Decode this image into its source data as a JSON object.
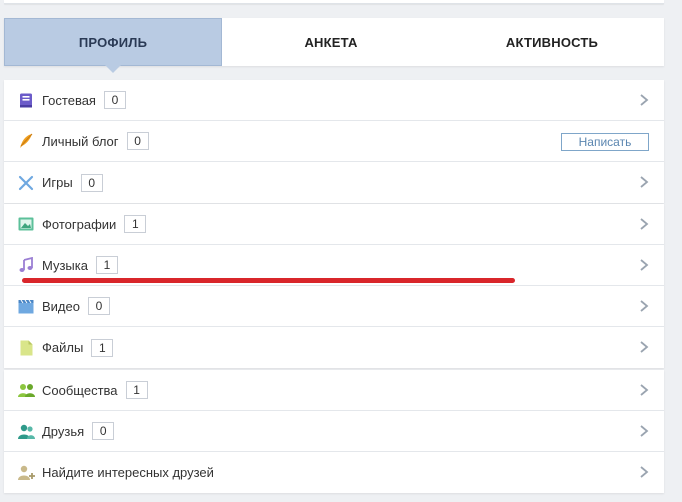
{
  "tabs": [
    {
      "label": "ПРОФИЛЬ",
      "active": true
    },
    {
      "label": "АНКЕТА",
      "active": false
    },
    {
      "label": "АКТИВНОСТЬ",
      "active": false
    }
  ],
  "groups": {
    "personal": {
      "guestbook": {
        "label": "Гостевая",
        "count": "0",
        "icon": "guestbook-icon"
      },
      "blog": {
        "label": "Личный блог",
        "count": "0",
        "icon": "quill-icon",
        "action": "Написать"
      },
      "games": {
        "label": "Игры",
        "count": "0",
        "icon": "swords-icon"
      }
    },
    "media": {
      "photos": {
        "label": "Фотографии",
        "count": "1",
        "icon": "photo-icon"
      },
      "music": {
        "label": "Музыка",
        "count": "1",
        "icon": "music-note-icon"
      },
      "video": {
        "label": "Видео",
        "count": "0",
        "icon": "film-icon"
      },
      "files": {
        "label": "Файлы",
        "count": "1",
        "icon": "file-icon"
      }
    },
    "social": {
      "communities": {
        "label": "Сообщества",
        "count": "1",
        "icon": "communities-icon"
      },
      "friends": {
        "label": "Друзья",
        "count": "0",
        "icon": "friends-icon"
      },
      "find_friends": {
        "label": "Найдите интересных друзей",
        "icon": "add-friend-icon"
      }
    }
  },
  "colors": {
    "active_tab": "#b9cbe3",
    "annotation_line": "#d9262b",
    "button_border": "#7fa6c9"
  }
}
